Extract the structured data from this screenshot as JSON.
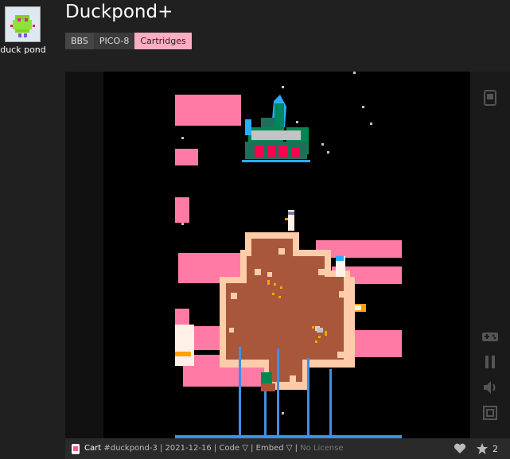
{
  "author": {
    "name": "duck pond"
  },
  "page": {
    "title": "Duckpond+"
  },
  "breadcrumb": [
    "BBS",
    "PICO-8",
    "Cartridges"
  ],
  "footer": {
    "cart_label": "Cart",
    "cart_id": "#duckpond-3",
    "sep1": " | ",
    "date": "2021-12-16",
    "sep2": " | ",
    "code": "Code ▽",
    "sep3": " | ",
    "embed": "Embed ▽",
    "sep4": " | ",
    "license": "No License",
    "like_count": "2"
  },
  "icons": {
    "cart": "cartridge-icon",
    "gamepad": "gamepad-icon",
    "pause": "pause-icon",
    "sound": "sound-icon",
    "fullscreen": "fullscreen-icon",
    "heart": "heart-icon",
    "star": "star-icon"
  },
  "colors": {
    "accent": "#ffadc0",
    "pond": "#a55a3a",
    "shore": "#ffccaa",
    "water_legs": "#3f8fe6"
  }
}
